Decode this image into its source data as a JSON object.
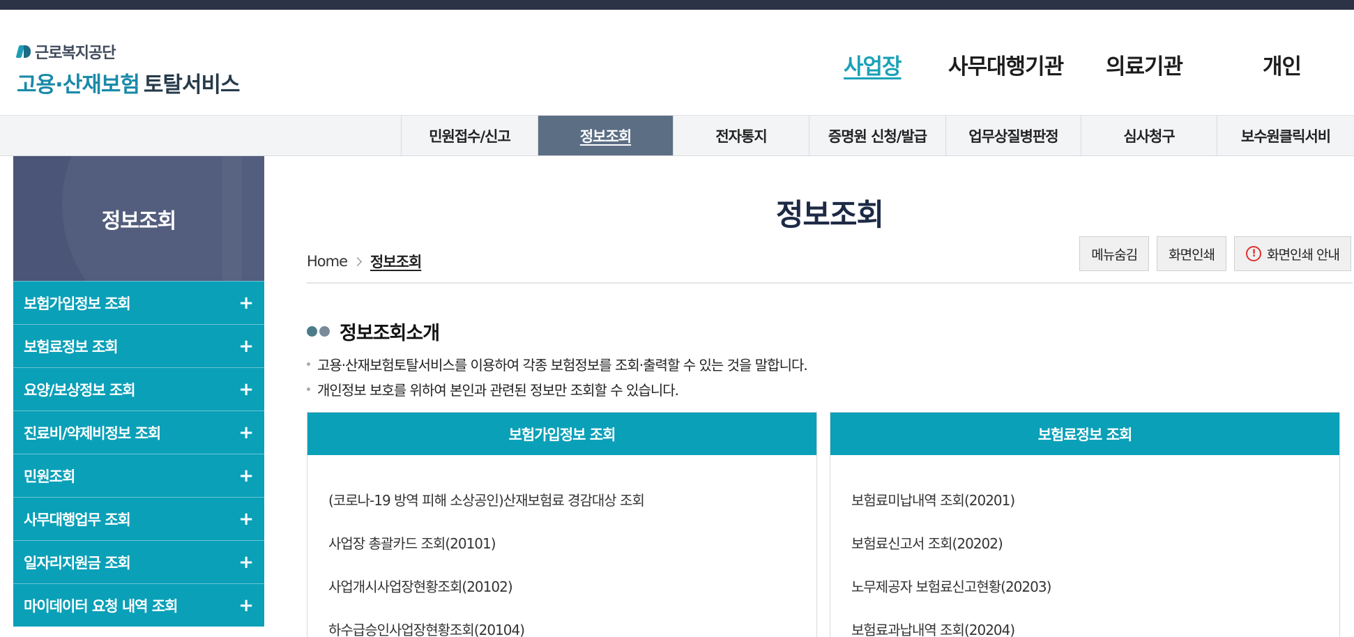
{
  "logo": {
    "org_name": "근로복지공단",
    "service_name_1": "고용·산재보험",
    "service_name_2": "토탈서비스"
  },
  "top_nav": [
    {
      "label": "사업장",
      "active": true
    },
    {
      "label": "사무대행기관",
      "active": false
    },
    {
      "label": "의료기관",
      "active": false
    },
    {
      "label": "개인",
      "active": false
    }
  ],
  "menu": [
    {
      "label": "민원접수/신고",
      "active": false
    },
    {
      "label": "정보조회",
      "active": true
    },
    {
      "label": "전자통지",
      "active": false
    },
    {
      "label": "증명원 신청/발급",
      "active": false
    },
    {
      "label": "업무상질병판정",
      "active": false
    },
    {
      "label": "심사청구",
      "active": false
    },
    {
      "label": "보수원클릭서비",
      "active": false
    }
  ],
  "sidebar": {
    "title": "정보조회",
    "items": [
      {
        "label": "보험가입정보 조회"
      },
      {
        "label": "보험료정보 조회"
      },
      {
        "label": "요양/보상정보 조회"
      },
      {
        "label": "진료비/약제비정보 조회"
      },
      {
        "label": "민원조회"
      },
      {
        "label": "사무대행업무 조회"
      },
      {
        "label": "일자리지원금 조회"
      },
      {
        "label": "마이데이터 요청 내역 조회"
      }
    ],
    "expand_icon": "+"
  },
  "page": {
    "title": "정보조회",
    "breadcrumb": {
      "home": "Home",
      "current": "정보조회"
    },
    "buttons": {
      "hide_menu": "메뉴숨김",
      "print": "화면인쇄",
      "print_guide": "화면인쇄 안내"
    },
    "warning_glyph": "!"
  },
  "intro": {
    "title": "정보조회소개",
    "bullets": [
      "고용·산재보험토탈서비스를 이용하여 각종 보험정보를 조회·출력할 수 있는 것을 말합니다.",
      "개인정보 보호를 위하여 본인과 관련된 정보만 조회할 수 있습니다."
    ]
  },
  "boxes": [
    {
      "title": "보험가입정보 조회",
      "items": [
        "(코로나-19 방역 피해 소상공인)산재보험료 경감대상 조회",
        "사업장 총괄카드 조회(20101)",
        "사업개시사업장현황조회(20102)",
        "하수급승인사업장현황조회(20104)"
      ]
    },
    {
      "title": "보험료정보 조회",
      "items": [
        "보험료미납내역 조회(20201)",
        "보험료신고서 조회(20202)",
        "노무제공자 보험료신고현황(20203)",
        "보험료과납내역 조회(20204)"
      ]
    }
  ],
  "colors": {
    "accent": "#0aa0b8",
    "nav_active": "#1aa1b8",
    "menu_active": "#5c6e84",
    "sidebar_head": "#4a5577",
    "topbar": "#2c3347"
  }
}
